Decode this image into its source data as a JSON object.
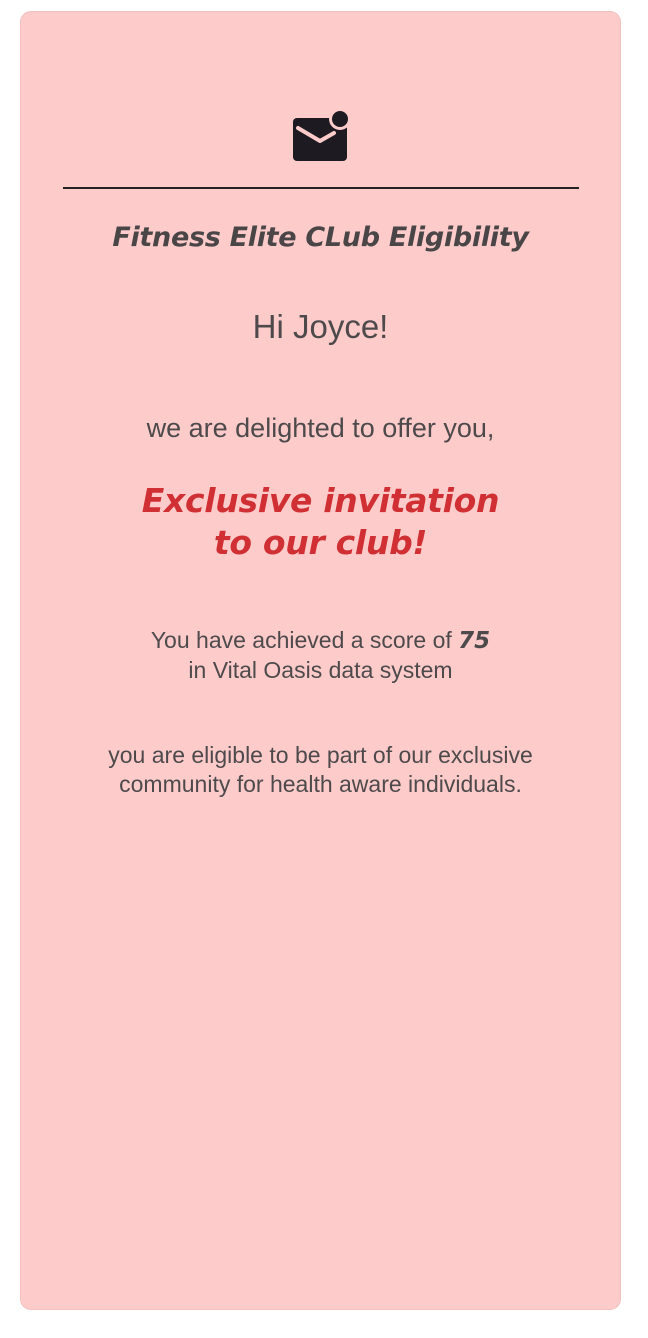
{
  "card": {
    "icon": "mail-notification-icon",
    "title": "Fitness Elite CLub Eligibility",
    "greeting": "Hi Joyce!",
    "intro": "we are delighted to offer you,",
    "headline_line1": "Exclusive invitation",
    "headline_line2": "to our club!",
    "score_prefix": "You have achieved a score of ",
    "score_value": "75",
    "score_suffix": "in Vital Oasis data system",
    "eligible_line1": "you are eligible to be part of our exclusive",
    "eligible_line2": "community for health aware individuals."
  },
  "colors": {
    "card_background": "#fecbcb",
    "headline": "#d03033",
    "text": "#4e4a4c",
    "icon": "#1e1a22"
  }
}
